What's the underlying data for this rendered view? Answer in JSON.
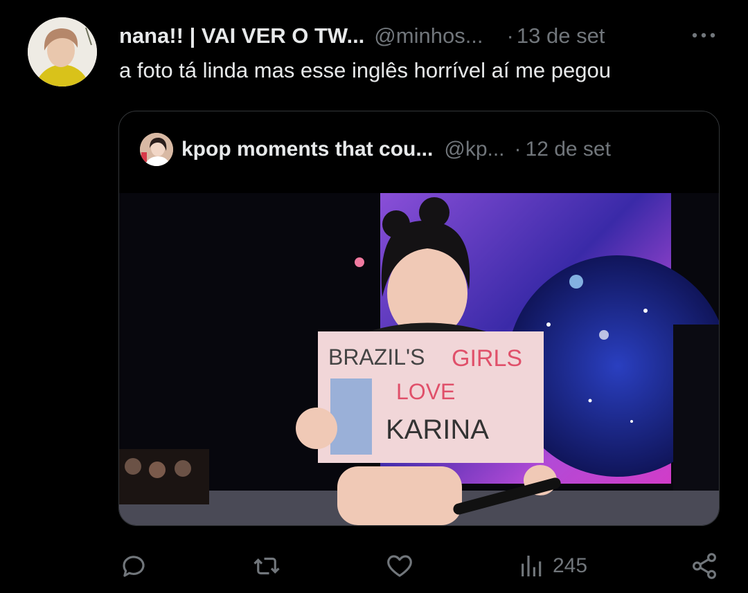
{
  "tweet": {
    "author_name": "nana!! | VAI VER O TW...",
    "author_handle": "@minhos...",
    "separator": "·",
    "date": "13 de set",
    "text": "a foto tá linda mas esse inglês horrível aí me pegou"
  },
  "quoted_tweet": {
    "author_name": "kpop moments that cou...",
    "author_handle": "@kp...",
    "separator": "·",
    "date": "12 de set",
    "media": {
      "sign_lines": [
        "BRAZIL'S",
        "GIRLS",
        "LOVE",
        "KARINA"
      ]
    }
  },
  "actions": {
    "reply_icon": "reply-icon",
    "retweet_icon": "retweet-icon",
    "like_icon": "heart-icon",
    "views_icon": "views-bar-chart-icon",
    "views_count": "245",
    "share_icon": "share-icon"
  },
  "colors": {
    "background": "#000000",
    "primary_text": "#e7e9ea",
    "secondary_text": "#71767b",
    "border": "#333639"
  }
}
